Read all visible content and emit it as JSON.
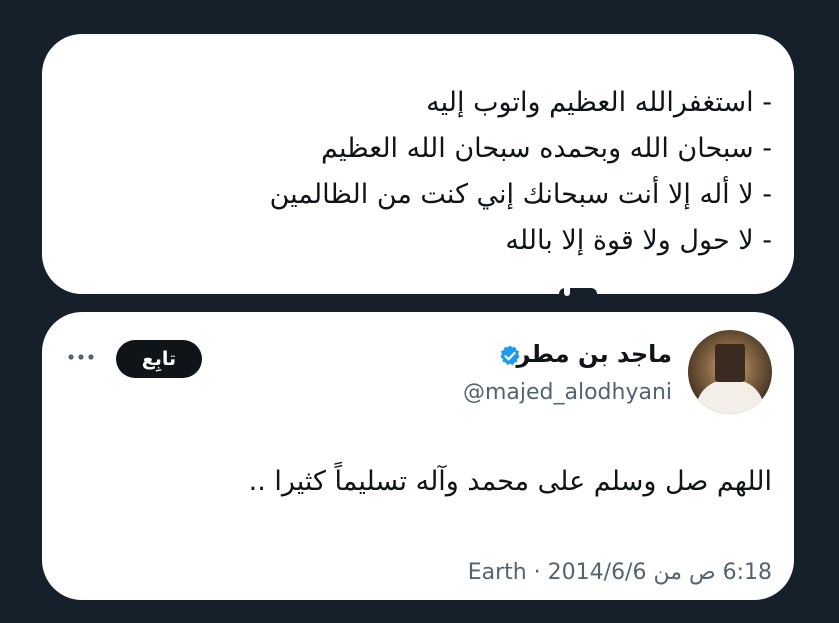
{
  "quote_card": {
    "lines": [
      "- استغفرالله العظيم واتوب إليه",
      "- سبحان الله وبحمده سبحان الله العظيم",
      "- لا أله إلا أنت سبحانك إني كنت من الظالمين",
      "- لا حول ولا قوة إلا بالله"
    ]
  },
  "tweet": {
    "author_name": "ماجد بن مطر",
    "handle": "@majed_alodhyani",
    "follow_label": "تابِع",
    "text": "اللهم صل وسلم على محمد وآله تسليماً كثيرا ..",
    "meta": "6:18 ص من Earth · 2014/6/6",
    "verified_icon": "verified-badge-icon",
    "more_icon": "more-options-icon",
    "verified_color": "#1d9bf0"
  }
}
